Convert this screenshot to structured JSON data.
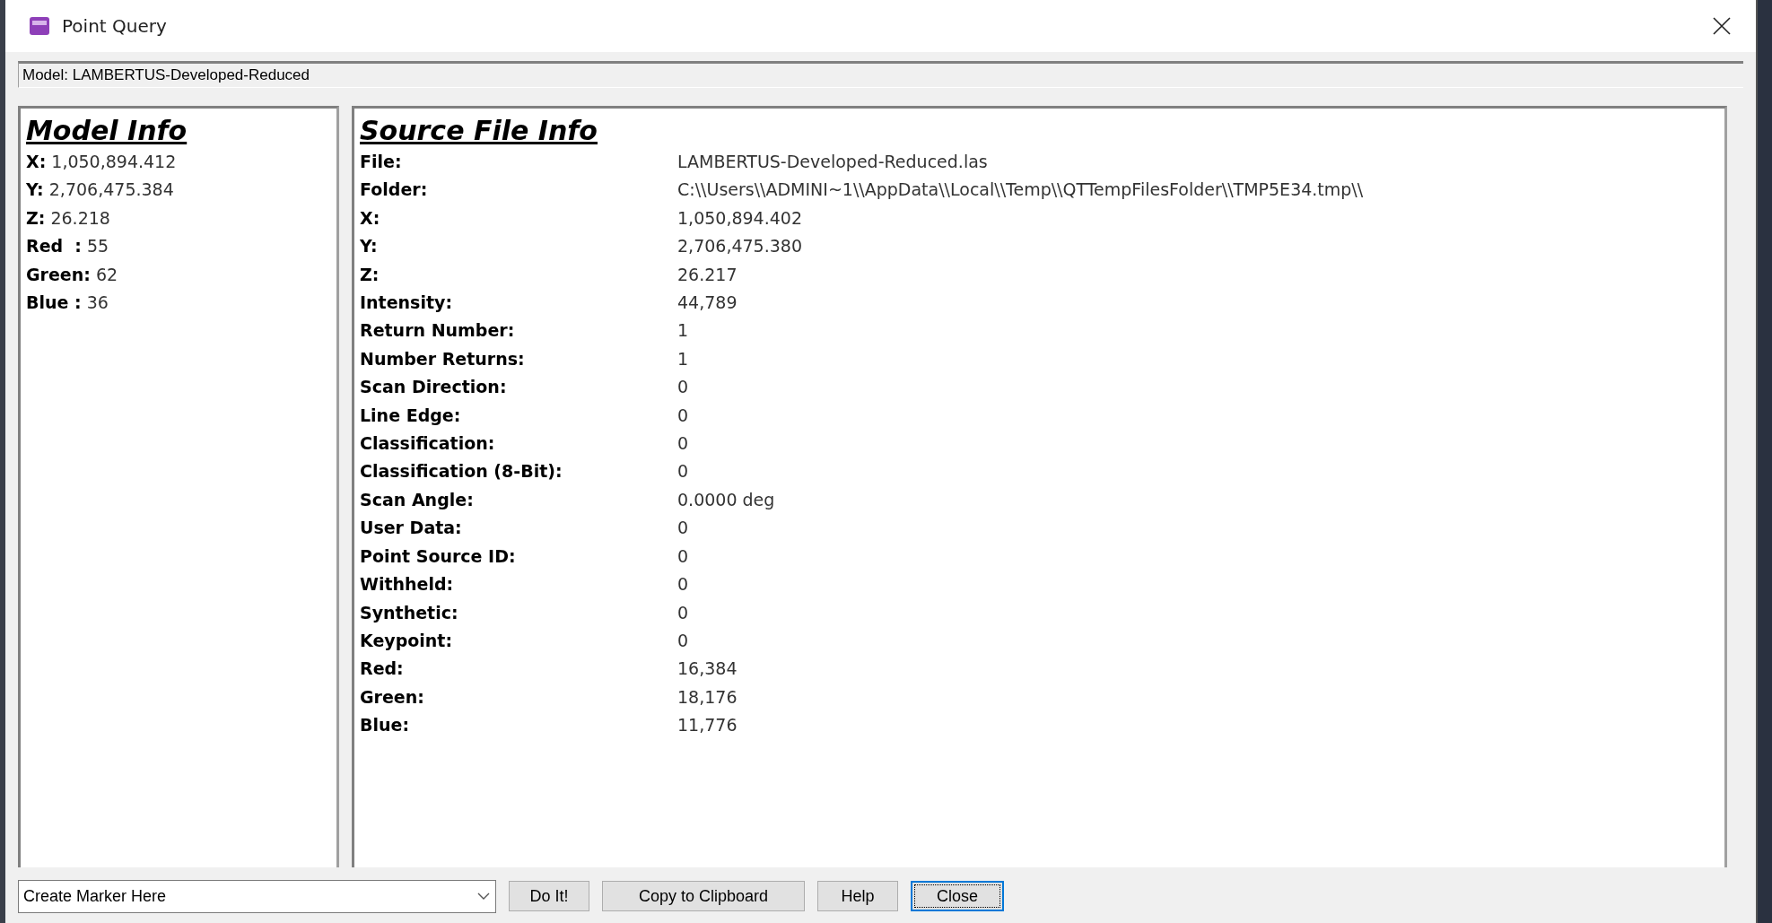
{
  "window": {
    "title": "Point Query"
  },
  "model_bar": {
    "text": "Model: LAMBERTUS-Developed-Reduced"
  },
  "model_info": {
    "title": "Model Info",
    "rows": [
      {
        "label": "X:",
        "value": "1,050,894.412"
      },
      {
        "label": "Y:",
        "value": "2,706,475.384"
      },
      {
        "label": "Z:",
        "value": "26.218"
      },
      {
        "label": "Red  :",
        "value": "55"
      },
      {
        "label": "Green:",
        "value": "62"
      },
      {
        "label": "Blue :",
        "value": "36"
      }
    ]
  },
  "source_file_info": {
    "title": "Source File Info",
    "rows": [
      {
        "label": "File:",
        "value": "LAMBERTUS-Developed-Reduced.las"
      },
      {
        "label": "Folder:",
        "value": "C:\\\\Users\\\\ADMINI~1\\\\AppData\\\\Local\\\\Temp\\\\QTTempFilesFolder\\\\TMP5E34.tmp\\\\"
      },
      {
        "label": "X:",
        "value": "1,050,894.402"
      },
      {
        "label": "Y:",
        "value": "2,706,475.380"
      },
      {
        "label": "Z:",
        "value": "26.217"
      },
      {
        "label": "Intensity:",
        "value": "44,789"
      },
      {
        "label": "Return Number:",
        "value": "1"
      },
      {
        "label": "Number Returns:",
        "value": "1"
      },
      {
        "label": "Scan Direction:",
        "value": "0"
      },
      {
        "label": "Line Edge:",
        "value": "0"
      },
      {
        "label": "Classification:",
        "value": "0"
      },
      {
        "label": "Classification (8-Bit):",
        "value": "0"
      },
      {
        "label": "Scan Angle:",
        "value": "0.0000 deg"
      },
      {
        "label": "User Data:",
        "value": "0"
      },
      {
        "label": "Point Source ID:",
        "value": "0"
      },
      {
        "label": "Withheld:",
        "value": "0"
      },
      {
        "label": "Synthetic:",
        "value": "0"
      },
      {
        "label": "Keypoint:",
        "value": "0"
      },
      {
        "label": "Red:",
        "value": "16,384"
      },
      {
        "label": "Green:",
        "value": "18,176"
      },
      {
        "label": "Blue:",
        "value": "11,776"
      }
    ]
  },
  "action_dropdown": {
    "value": "Create Marker Here"
  },
  "buttons": [
    {
      "label": "Do It!",
      "focused": false
    },
    {
      "label": "Copy to Clipboard",
      "focused": false
    },
    {
      "label": "Help",
      "focused": false
    },
    {
      "label": "Close",
      "focused": true
    }
  ]
}
